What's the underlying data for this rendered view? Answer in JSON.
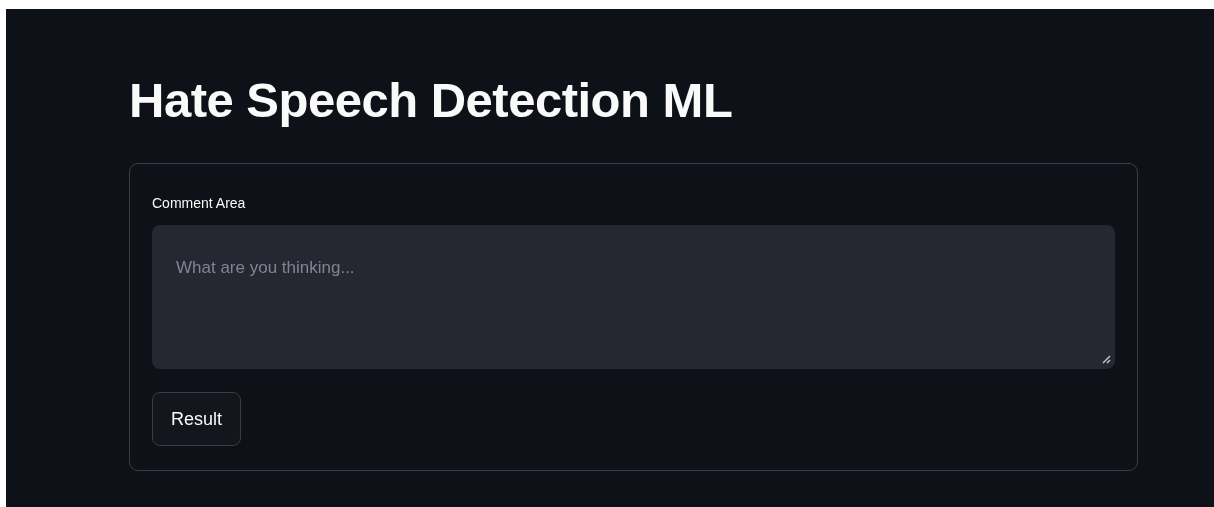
{
  "title": "Hate Speech Detection ML",
  "form": {
    "field_label": "Comment Area",
    "placeholder": "What are you thinking...",
    "button": "Result"
  }
}
